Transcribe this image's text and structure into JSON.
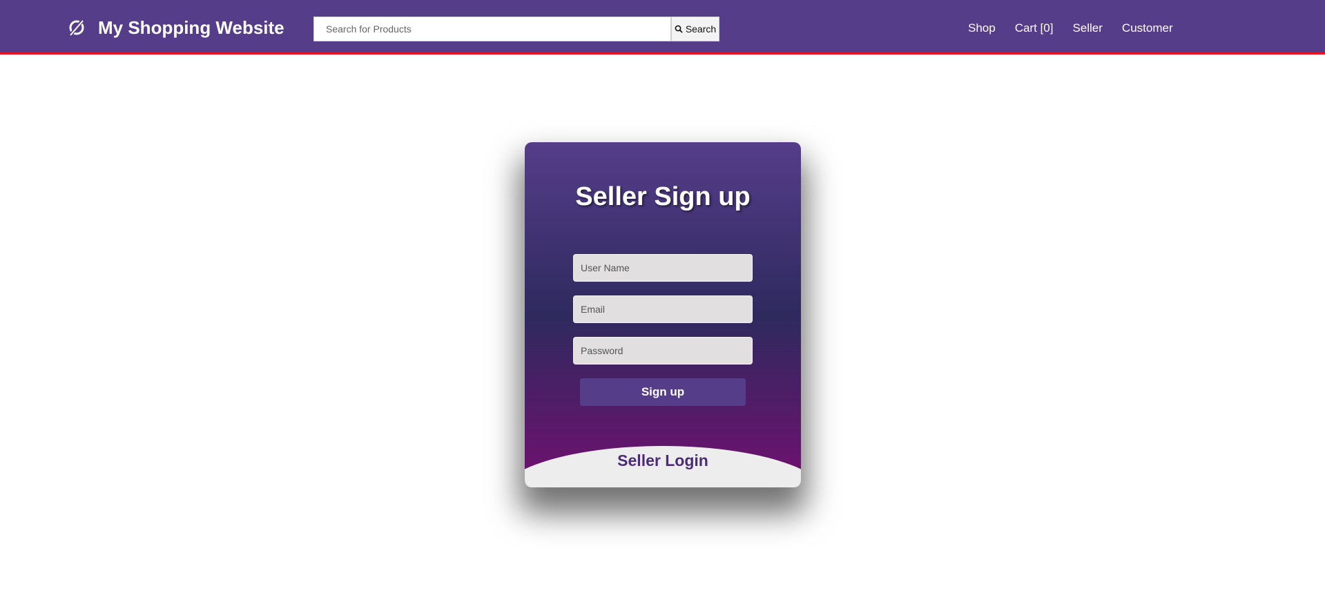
{
  "colors": {
    "navbar_bg": "#563d8a",
    "navbar_border": "#e8121e",
    "card_gradient_top": "#563d8a",
    "card_gradient_mid": "#2e2a5e",
    "card_gradient_bottom": "#711070",
    "login_text": "#4a2c7a"
  },
  "navbar": {
    "brand_icon": "circle-swoosh-logo-icon",
    "brand_name": "My Shopping Website",
    "search": {
      "placeholder": "Search for Products",
      "value": "",
      "button_icon": "search-icon",
      "button_label": "Search"
    },
    "links": [
      {
        "label": "Shop"
      },
      {
        "label": "Cart [0]"
      },
      {
        "label": "Seller"
      },
      {
        "label": "Customer"
      }
    ]
  },
  "signup_card": {
    "title": "Seller Sign up",
    "fields": {
      "username": {
        "placeholder": "User Name",
        "value": ""
      },
      "email": {
        "placeholder": "Email",
        "value": ""
      },
      "password": {
        "placeholder": "Password",
        "value": ""
      }
    },
    "submit_label": "Sign up",
    "login_link_label": "Seller Login"
  }
}
